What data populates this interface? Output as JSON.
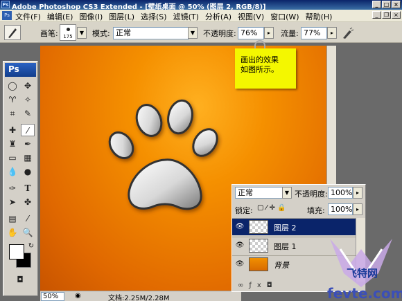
{
  "window": {
    "title": "Adobe Photoshop CS3 Extended - [壁纸桌面 @ 50% (图层 2, RGB/8)]"
  },
  "menu": [
    "文件(F)",
    "编辑(E)",
    "图像(I)",
    "图层(L)",
    "选择(S)",
    "滤镜(T)",
    "分析(A)",
    "视图(V)",
    "窗口(W)",
    "帮助(H)"
  ],
  "options": {
    "brush_label": "画笔:",
    "brush_size": "175",
    "mode_label": "模式:",
    "mode_value": "正常",
    "opacity_label": "不透明度:",
    "opacity_value": "76%",
    "flow_label": "流量:",
    "flow_value": "77%"
  },
  "toolbox": {
    "logo": "Ps",
    "fg_color": "#ffffff",
    "bg_color": "#000000"
  },
  "note": {
    "line1": "画出的效果",
    "line2": "如图所示。"
  },
  "status": {
    "zoom": "50%",
    "doc": "文档:2.25M/2.28M"
  },
  "layers": {
    "blend_mode": "正常",
    "opacity_label": "不透明度:",
    "opacity_value": "100%",
    "lock_label": "锁定:",
    "fill_label": "填充:",
    "fill_value": "100%",
    "items": [
      {
        "name": "图层 2",
        "selected": true
      },
      {
        "name": "图层 1",
        "selected": false
      },
      {
        "name": "背景",
        "selected": false
      }
    ]
  },
  "watermark": {
    "brand_cn": "飞特网",
    "brand_en": "fevte.com"
  },
  "colors": {
    "canvas_center": "#ffb020",
    "canvas_edge": "#c85400",
    "note_bg": "#f4f700",
    "layer_selected": "#0a246a"
  }
}
